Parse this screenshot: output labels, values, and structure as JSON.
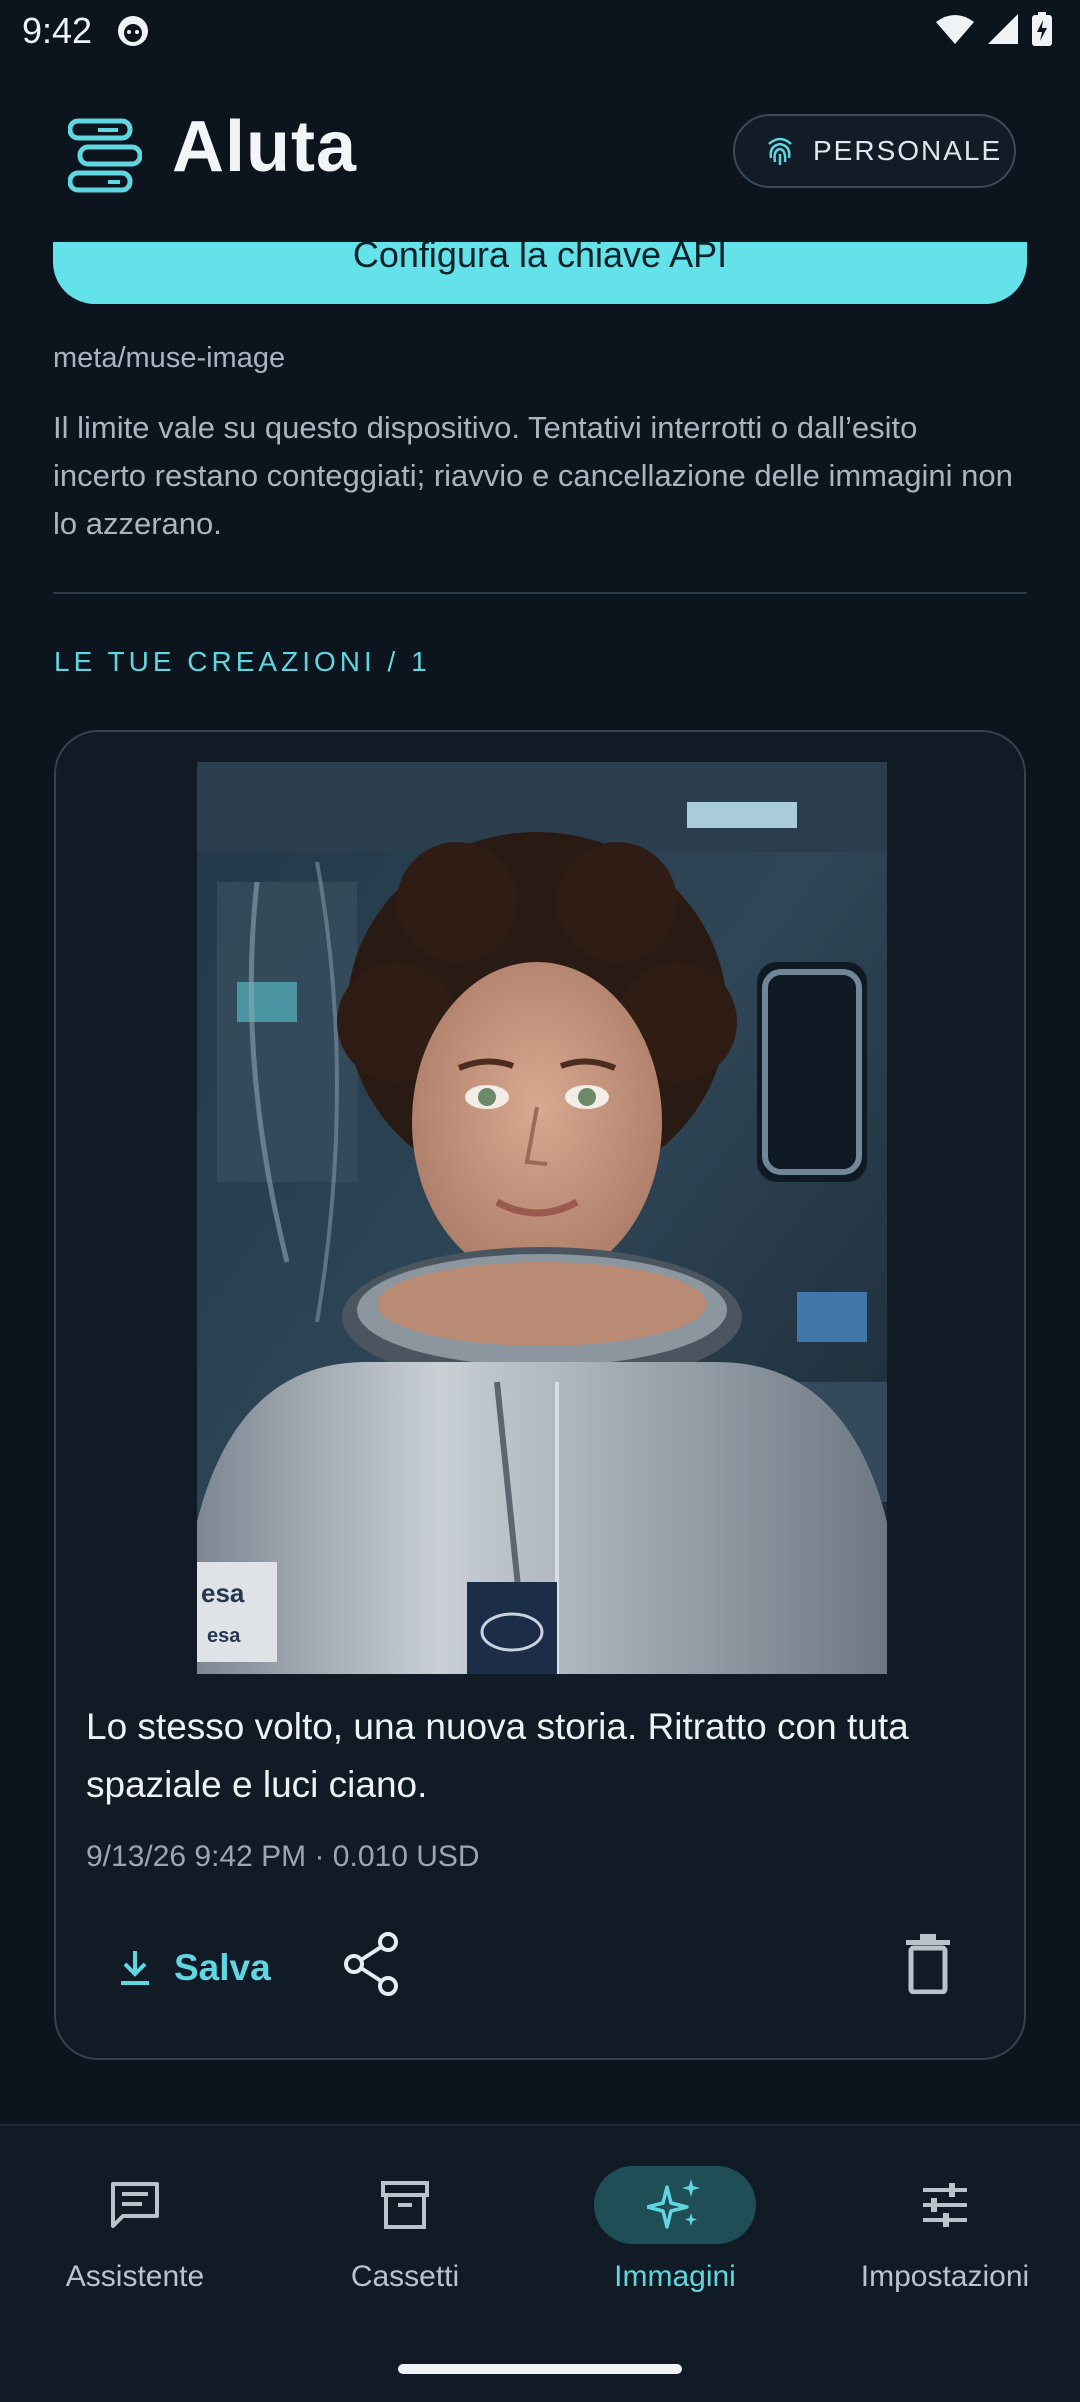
{
  "status": {
    "time": "9:42"
  },
  "header": {
    "app_title": "Aluta",
    "profile_label": "PERSONALE"
  },
  "api_button": {
    "label": "Configura la chiave API"
  },
  "model": {
    "id": "meta/muse-image"
  },
  "notice": {
    "text": "Il limite vale su questo dispositivo. Tentativi interrotti o dall’esito incerto restano conteggiati; riavvio e cancellazione delle immagini non lo azzerano."
  },
  "creations": {
    "section_title": "LE TUE CREAZIONI / 1",
    "items": [
      {
        "caption": "Lo stesso volto, una nuova storia. Ritratto con tuta spaziale e luci ciano.",
        "meta": "9/13/26 9:42 PM · 0.010 USD",
        "save_label": "Salva",
        "patch_text": "esa"
      }
    ]
  },
  "nav": {
    "items": [
      {
        "label": "Assistente",
        "icon": "chat-icon"
      },
      {
        "label": "Cassetti",
        "icon": "archive-icon"
      },
      {
        "label": "Immagini",
        "icon": "sparkle-icon",
        "active": true
      },
      {
        "label": "Impostazioni",
        "icon": "sliders-icon"
      }
    ]
  },
  "colors": {
    "accent": "#5fd6e0",
    "button": "#63e2ea",
    "background": "#0c141e"
  }
}
